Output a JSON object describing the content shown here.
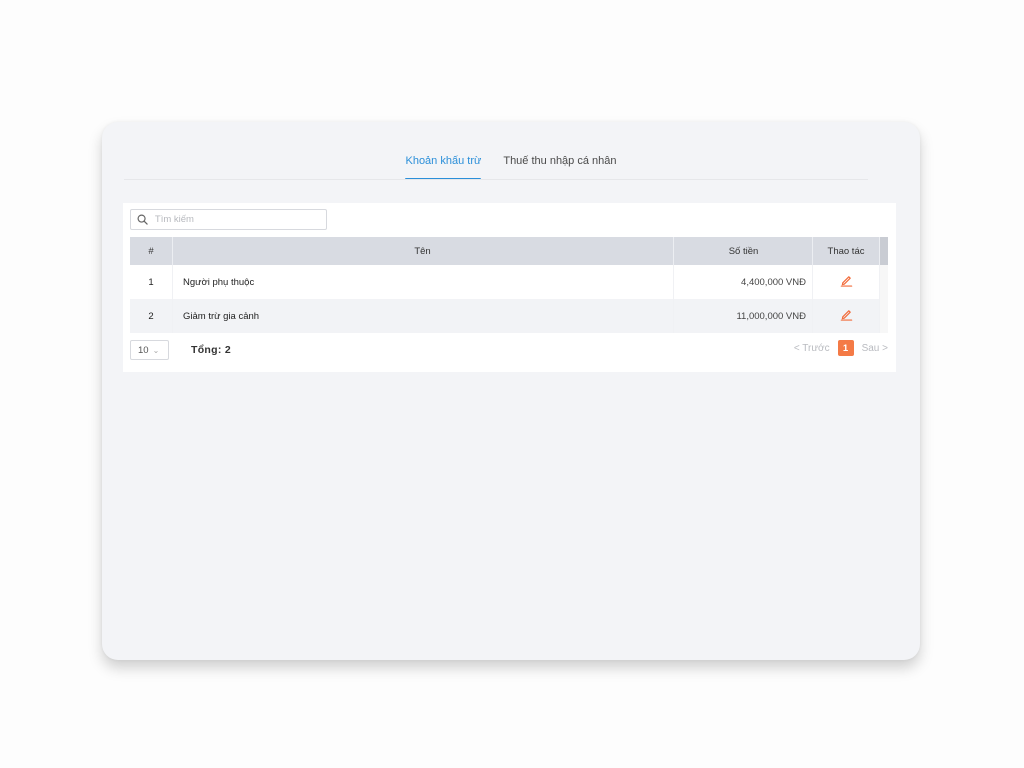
{
  "tabs": [
    {
      "label": "Khoản khấu trừ",
      "active": true
    },
    {
      "label": "Thuế thu nhập cá nhân",
      "active": false
    }
  ],
  "search": {
    "placeholder": "Tìm kiếm",
    "value": ""
  },
  "table": {
    "headers": {
      "num": "#",
      "name": "Tên",
      "amount": "Số tiền",
      "actions": "Thao tác"
    },
    "rows": [
      {
        "num": "1",
        "name": "Người phụ thuộc",
        "amount": "4,400,000 VNĐ"
      },
      {
        "num": "2",
        "name": "Giảm trừ gia cảnh",
        "amount": "11,000,000 VNĐ"
      }
    ]
  },
  "footer": {
    "page_size": "10",
    "total_label": "Tổng: 2",
    "prev_label": "< Trước",
    "current_page": "1",
    "next_label": "Sau >"
  },
  "colors": {
    "accent": "#2b8fd9",
    "page_active": "#f47a46",
    "edit_icon": "#f26b3a"
  },
  "icons": {
    "search": "search-icon",
    "edit": "pencil-icon",
    "chevron": "chevron-down-icon"
  }
}
